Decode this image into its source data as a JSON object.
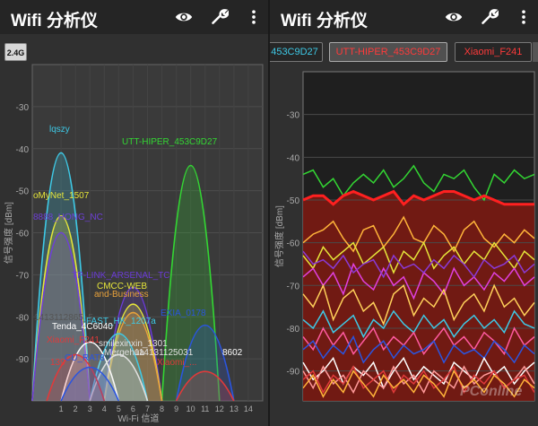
{
  "left": {
    "app_title": "Wifi 分析仪",
    "band_button": "2.4G",
    "icons": [
      "eye-icon",
      "wrench-icon",
      "more-vert-icon"
    ],
    "chart_data": {
      "type": "area",
      "title": "",
      "xlabel": "Wi-Fi 信道",
      "ylabel": "信号强度 [dBm]",
      "ylim": [
        -100,
        -20
      ],
      "yticks": [
        -30,
        -40,
        -50,
        -60,
        -70,
        -80,
        -90
      ],
      "xticks": [
        1,
        2,
        3,
        4,
        5,
        6,
        7,
        8,
        9,
        10,
        11,
        12,
        13,
        14
      ],
      "networks": [
        {
          "name": "lqszy",
          "channel": 1,
          "width": 4,
          "peak": -41,
          "color": "#3ec9e6"
        },
        {
          "name": "oMyNet_1507",
          "channel": 1,
          "width": 4,
          "peak": -56,
          "color": "#e6e63a"
        },
        {
          "name": "8888_HONG_NC",
          "channel": 1,
          "width": 4,
          "peak": -60,
          "color": "#6e3fd8"
        },
        {
          "name": "UTT-HIPER_453C9D27",
          "channel": 10,
          "width": 4,
          "peak": -44,
          "color": "#33d633"
        },
        {
          "name": "TP-LINK_ARSENAL_TC",
          "channel": 6,
          "width": 4,
          "peak": -73,
          "color": "#6a3ad6"
        },
        {
          "name": "CMCC-WEB",
          "channel": 6,
          "width": 4,
          "peak": -77,
          "color": "#e6e63a"
        },
        {
          "name": "and-Business",
          "channel": 6,
          "width": 4,
          "peak": -79,
          "color": "#e8a23a"
        },
        {
          "name": "FAST_HK_1207a",
          "channel": 5,
          "width": 4,
          "peak": -84,
          "color": "#3ec9e6"
        },
        {
          "name": "EXIA_0178",
          "channel": 11,
          "width": 4,
          "peak": -82,
          "color": "#2a55e0"
        },
        {
          "name": "Tenda_4C6040",
          "channel": 3,
          "width": 4,
          "peak": -86,
          "color": "#ffffff"
        },
        {
          "name": "smilexinxin_1301",
          "channel": 5,
          "width": 4,
          "peak": -89,
          "color": "#e0e0e0"
        },
        {
          "name": "Xiaomi_F241",
          "channel": 2,
          "width": 4,
          "peak": -89,
          "color": "#e03a3a"
        },
        {
          "name": "CU_RAT8",
          "channel": 3,
          "width": 4,
          "peak": -92,
          "color": "#2a55e0"
        },
        {
          "name": "Xiaomi_...",
          "channel": 11,
          "width": 4,
          "peak": -93,
          "color": "#e03a3a"
        }
      ],
      "labels": [
        {
          "text": "lqszy",
          "color": "#3ec9e6"
        },
        {
          "text": "oMyNet_1507",
          "color": "#e6e63a"
        },
        {
          "text": "8888_HONG_NC",
          "color": "#6e3fd8"
        },
        {
          "text": "UTT-HIPER_453C9D27",
          "color": "#33d633"
        },
        {
          "text": "TP-LINK_ARSENAL_TC",
          "color": "#6a3ad6"
        },
        {
          "text": "CMCC-WEB",
          "color": "#e6e63a"
        },
        {
          "text": "and-Business",
          "color": "#e8a23a"
        },
        {
          "text": "1413112865_5",
          "color": "#555555"
        },
        {
          "text": "FAST_HK_1207a",
          "color": "#3ec9e6"
        },
        {
          "text": "EXIA_0178",
          "color": "#2a55e0"
        },
        {
          "text": "Tenda_4C6040",
          "color": "#ffffff"
        },
        {
          "text": "smilexinxin_1301",
          "color": "#e0e0e0"
        },
        {
          "text": "Xiaomi_F241",
          "color": "#e03a3a"
        },
        {
          "text": "CU_RAT8",
          "color": "#2a55e0"
        },
        {
          "text": "Mergehua",
          "color": "#e0e0e0"
        },
        {
          "text": "114131125031",
          "color": "#e0e0e0"
        },
        {
          "text": "8602",
          "color": "#ffffff"
        },
        {
          "text": "Xiaomi_...",
          "color": "#e03a3a"
        },
        {
          "text": "139",
          "color": "#e03a3a"
        }
      ]
    }
  },
  "right": {
    "app_title": "Wifi 分析仪",
    "icons": [
      "eye-icon",
      "wrench-icon",
      "more-vert-icon"
    ],
    "tabs": [
      {
        "label": "453C9D27",
        "color": "#3ec9e6",
        "selected": false
      },
      {
        "label": "UTT-HIPER_453C9D27",
        "color": "#ff3a3a",
        "selected": true
      },
      {
        "label": "Xiaomi_F241",
        "color": "#ff3a3a",
        "selected": false
      }
    ],
    "chart_data": {
      "type": "line",
      "title": "",
      "ylabel": "信号强度 [dBm]",
      "ylim": [
        -97,
        -20
      ],
      "yticks": [
        -30,
        -40,
        -50,
        -60,
        -70,
        -80,
        -90
      ],
      "series": [
        {
          "color": "#33d633",
          "values": [
            -44,
            -43,
            -47,
            -45,
            -49,
            -46,
            -44,
            -46,
            -43,
            -47,
            -45,
            -42,
            -46,
            -48,
            -44,
            -45,
            -43,
            -47,
            -50,
            -44,
            -46,
            -43,
            -45,
            -44
          ]
        },
        {
          "color": "#ff2020",
          "values": [
            -50,
            -49,
            -49,
            -51,
            -49,
            -48,
            -49,
            -50,
            -49,
            -48,
            -51,
            -49,
            -50,
            -49,
            -48,
            -48,
            -49,
            -50,
            -49,
            -50,
            -51,
            -51,
            -51,
            -51
          ]
        },
        {
          "color": "#ffb43a",
          "values": [
            -60,
            -58,
            -57,
            -55,
            -59,
            -62,
            -57,
            -56,
            -61,
            -58,
            -54,
            -59,
            -60,
            -56,
            -58,
            -62,
            -57,
            -55,
            -59,
            -61,
            -58,
            -60,
            -57,
            -59
          ]
        },
        {
          "color": "#e6e63a",
          "values": [
            -63,
            -66,
            -61,
            -64,
            -62,
            -60,
            -65,
            -63,
            -61,
            -67,
            -62,
            -64,
            -60,
            -66,
            -63,
            -61,
            -65,
            -62,
            -64,
            -60,
            -63,
            -66,
            -62,
            -64
          ]
        },
        {
          "color": "#e040e0",
          "values": [
            -68,
            -66,
            -70,
            -67,
            -72,
            -65,
            -69,
            -71,
            -66,
            -70,
            -68,
            -73,
            -67,
            -69,
            -72,
            -66,
            -70,
            -68,
            -71,
            -67,
            -69,
            -66,
            -70,
            -68
          ]
        },
        {
          "color": "#8a3ad6",
          "values": [
            -62,
            -65,
            -64,
            -66,
            -63,
            -67,
            -65,
            -64,
            -68,
            -63,
            -66,
            -65,
            -67,
            -64,
            -66,
            -63,
            -65,
            -68,
            -64,
            -66,
            -65,
            -63,
            -67,
            -65
          ]
        },
        {
          "color": "#ffd05a",
          "values": [
            -72,
            -75,
            -70,
            -78,
            -73,
            -71,
            -76,
            -74,
            -79,
            -72,
            -70,
            -77,
            -73,
            -75,
            -71,
            -78,
            -74,
            -72,
            -76,
            -70,
            -75,
            -73,
            -77,
            -74
          ]
        },
        {
          "color": "#3ec9e6",
          "values": [
            -78,
            -80,
            -76,
            -81,
            -79,
            -77,
            -82,
            -78,
            -80,
            -76,
            -79,
            -81,
            -77,
            -80,
            -78,
            -82,
            -79,
            -77,
            -80,
            -78,
            -81,
            -76,
            -79,
            -80
          ]
        },
        {
          "color": "#ff5aa0",
          "values": [
            -82,
            -85,
            -80,
            -84,
            -81,
            -86,
            -83,
            -80,
            -85,
            -82,
            -84,
            -81,
            -86,
            -83,
            -80,
            -84,
            -82,
            -85,
            -81,
            -83,
            -86,
            -80,
            -84,
            -82
          ]
        },
        {
          "color": "#2a55e0",
          "values": [
            -85,
            -83,
            -87,
            -84,
            -86,
            -82,
            -88,
            -85,
            -83,
            -87,
            -84,
            -86,
            -85,
            -83,
            -88,
            -84,
            -86,
            -85,
            -87,
            -83,
            -85,
            -88,
            -84,
            -86
          ]
        },
        {
          "color": "#ffffff",
          "values": [
            -88,
            -92,
            -90,
            -87,
            -93,
            -89,
            -91,
            -88,
            -94,
            -90,
            -87,
            -92,
            -89,
            -91,
            -93,
            -88,
            -90,
            -92,
            -87,
            -91,
            -89,
            -93,
            -90,
            -88
          ]
        },
        {
          "color": "#ff9a9a",
          "values": [
            -90,
            -94,
            -89,
            -93,
            -91,
            -95,
            -90,
            -92,
            -94,
            -89,
            -93,
            -91,
            -95,
            -90,
            -92,
            -94,
            -89,
            -93,
            -91,
            -90,
            -94,
            -92,
            -89,
            -93
          ]
        },
        {
          "color": "#e03a3a",
          "values": [
            -92,
            -90,
            -95,
            -91,
            -93,
            -89,
            -94,
            -92,
            -90,
            -95,
            -91,
            -93,
            -90,
            -94,
            -92,
            -89,
            -95,
            -91,
            -93,
            -90,
            -94,
            -92,
            -91,
            -95
          ]
        },
        {
          "color": "#ffb43a",
          "values": [
            -94,
            -91,
            -96,
            -92,
            -95,
            -90,
            -93,
            -96,
            -91,
            -94,
            -92,
            -95,
            -91,
            -93,
            -96,
            -90,
            -94,
            -92,
            -95,
            -91,
            -93,
            -96,
            -92,
            -94
          ]
        }
      ],
      "highlighted_series_index": 1,
      "fill_color": "#7a1a12"
    },
    "watermark": "PConline"
  }
}
